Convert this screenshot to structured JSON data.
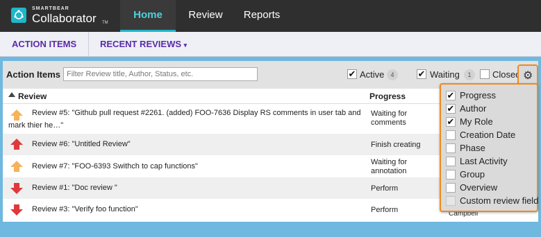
{
  "brand": {
    "small": "SMARTBEAR",
    "name": "Collaborator",
    "tm": "TM"
  },
  "nav": {
    "tabs": [
      {
        "label": "Home"
      },
      {
        "label": "Review"
      },
      {
        "label": "Reports"
      }
    ]
  },
  "subnav": {
    "items": [
      {
        "label": "ACTION ITEMS"
      },
      {
        "label": "RECENT REVIEWS"
      }
    ],
    "caret": "▾"
  },
  "panel": {
    "title": "Action Items",
    "filter_placeholder": "Filter Review title, Author, Status, etc.",
    "filters": [
      {
        "label": "Active",
        "checked": true,
        "count": "4"
      },
      {
        "label": "Waiting",
        "checked": true,
        "count": "1"
      },
      {
        "label": "Closed",
        "checked": false
      }
    ]
  },
  "table": {
    "columns": [
      "Review",
      "Progress"
    ],
    "rows": [
      {
        "arrow": "up-orange",
        "title_line1": "Review #5: \"Github pull request #2261. (added) FOO-7636 Display RS comments in user tab and",
        "title_line2": "mark thier he…\"",
        "progress_line1": "Waiting for",
        "progress_line2": "comments",
        "extra": ""
      },
      {
        "arrow": "up-red",
        "title_line1": "Review #6: \"Untitled Review\"",
        "title_line2": "",
        "progress_line1": "Finish creating",
        "progress_line2": "",
        "extra": ""
      },
      {
        "arrow": "up-orange",
        "title_line1": "Review #7: \"FOO-6393 Swithch to cap functions\"",
        "title_line2": "",
        "progress_line1": "Waiting for",
        "progress_line2": "annotation",
        "extra": ""
      },
      {
        "arrow": "down-red",
        "title_line1": "Review #1: \"Doc review \"",
        "title_line2": "",
        "progress_line1": "Perform",
        "progress_line2": "",
        "extra": ""
      },
      {
        "arrow": "down-red",
        "title_line1": "Review #3: \"Verify foo function\"",
        "title_line2": "",
        "progress_line1": "Perform",
        "progress_line2": "",
        "extra": "Campbell"
      }
    ]
  },
  "columns_menu": {
    "items": [
      {
        "label": "Progress",
        "checked": true
      },
      {
        "label": "Author",
        "checked": true
      },
      {
        "label": "My Role",
        "checked": true
      },
      {
        "label": "Creation Date",
        "checked": false
      },
      {
        "label": "Phase",
        "checked": false
      },
      {
        "label": "Last Activity",
        "checked": false
      },
      {
        "label": "Group",
        "checked": false
      },
      {
        "label": "Overview",
        "checked": false
      },
      {
        "label": "Custom review field",
        "checked": false
      }
    ]
  },
  "colors": {
    "accent": "#21b5c9",
    "purple": "#5a2aa8",
    "highlight": "#f08a1c",
    "up_orange": "#f5b35a",
    "red": "#e0393c"
  }
}
